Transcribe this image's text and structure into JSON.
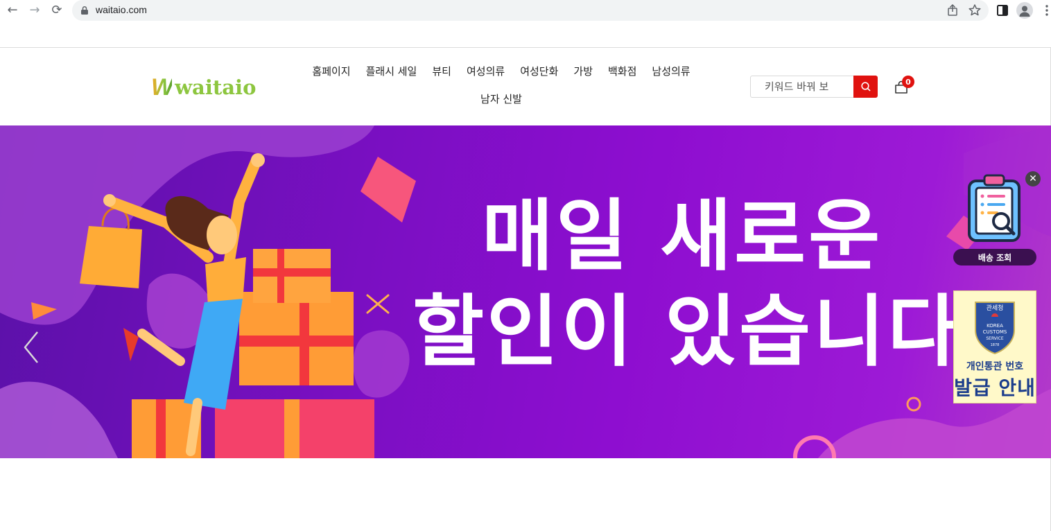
{
  "browser": {
    "url": "waitaio.com",
    "buttons": {
      "back": "←",
      "forward": "→",
      "reload": "⟳"
    }
  },
  "site": {
    "logo_mark": "W",
    "logo_text": "waitaio",
    "nav": [
      "홈페이지",
      "플래시 세일",
      "뷰티",
      "여성의류",
      "여성단화",
      "가방",
      "백화점",
      "남성의류",
      "남자 신발"
    ],
    "search": {
      "placeholder": "키워드 바꿔 보"
    },
    "cart_count": "0"
  },
  "banner": {
    "line1": "매일 새로운",
    "line2": "할인이 있습니다"
  },
  "widgets": {
    "tracking_label": "배송 조회",
    "close": "✕",
    "customs_seal_top": "관세청",
    "customs_seal_mid1": "KOREA",
    "customs_seal_mid2": "CUSTOMS",
    "customs_seal_mid3": "SERVICE",
    "customs_seal_year": "1878",
    "customs_line1": "개인통관 번호",
    "customs_line2": "발급 안내"
  },
  "colors": {
    "accent_red": "#e0120f",
    "logo_green": "#8dc63f",
    "banner_purple": "#7a0fc2"
  }
}
